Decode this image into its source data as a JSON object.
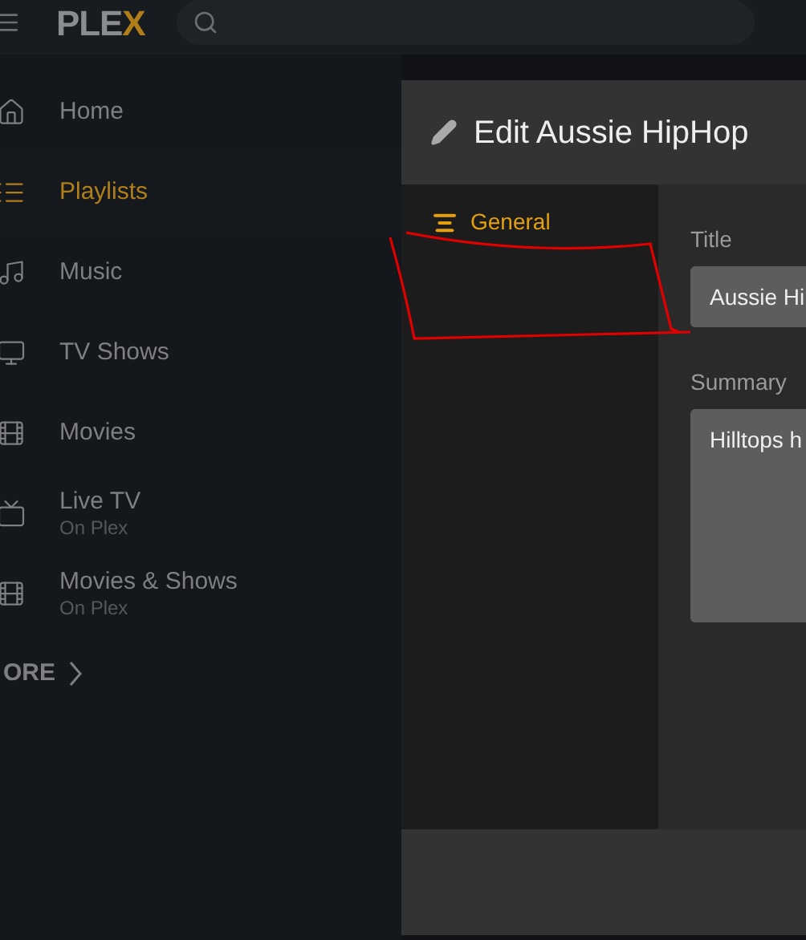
{
  "top_bar": {
    "logo": {
      "text": "PLE",
      "accent": "X"
    }
  },
  "sidebar": {
    "items": [
      {
        "kind": "home",
        "label": "Home",
        "selected": false
      },
      {
        "kind": "playlist",
        "label": "Playlists",
        "selected": true
      },
      {
        "kind": "music",
        "label": "Music",
        "selected": false
      },
      {
        "kind": "tv",
        "label": "TV Shows",
        "selected": false
      },
      {
        "kind": "film",
        "label": "Movies",
        "selected": false
      },
      {
        "kind": "live",
        "label": "Live TV",
        "sublabel": "On Plex",
        "selected": false
      },
      {
        "kind": "film",
        "label": "Movies & Shows",
        "sublabel": "On Plex",
        "selected": false
      }
    ],
    "more": "ORE"
  },
  "dialog": {
    "title": "Edit Aussie HipHop",
    "tabs": [
      {
        "label": "General",
        "selected": true
      }
    ],
    "fields": [
      {
        "kind": "input",
        "label": "Title",
        "value": "Aussie Hi"
      },
      {
        "kind": "textarea",
        "label": "Summary",
        "value": "Hilltops h"
      }
    ]
  }
}
